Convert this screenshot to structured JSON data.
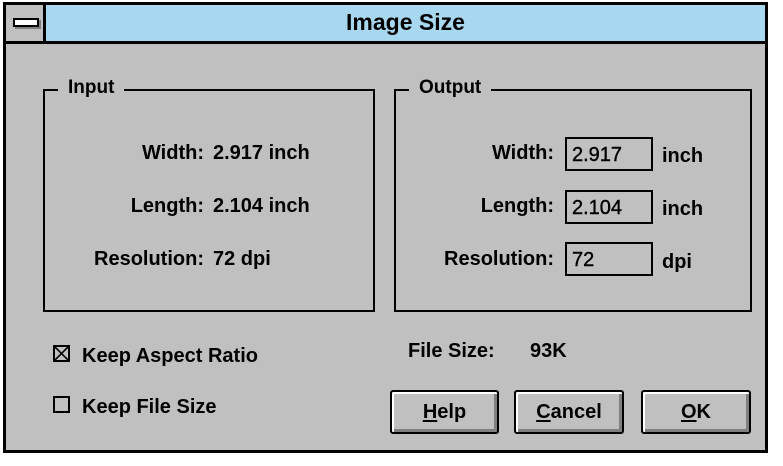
{
  "window": {
    "title": "Image Size"
  },
  "input": {
    "group_title": "Input",
    "width_label": "Width:",
    "width_value": "2.917 inch",
    "length_label": "Length:",
    "length_value": "2.104 inch",
    "resolution_label": "Resolution:",
    "resolution_value": "72 dpi"
  },
  "output": {
    "group_title": "Output",
    "width_label": "Width:",
    "width_value": "2.917",
    "width_unit": "inch",
    "length_label": "Length:",
    "length_value": "2.104",
    "length_unit": "inch",
    "resolution_label": "Resolution:",
    "resolution_value": "72",
    "resolution_unit": "dpi"
  },
  "options": {
    "keep_aspect_ratio": {
      "label": "Keep Aspect Ratio",
      "checked": true
    },
    "keep_file_size": {
      "label": "Keep File Size",
      "checked": false
    }
  },
  "file_size": {
    "label": "File Size:",
    "value": "93K"
  },
  "buttons": {
    "help_mnemonic": "H",
    "help_rest": "elp",
    "cancel_mnemonic": "C",
    "cancel_rest": "ancel",
    "ok_mnemonic": "O",
    "ok_rest": "K"
  },
  "colors": {
    "dialog_bg": "#c0c0c0",
    "titlebar_bg": "#a8d8f0"
  },
  "icons": {
    "system_menu": "system-menu-icon",
    "checked": "checkbox-x-icon"
  }
}
